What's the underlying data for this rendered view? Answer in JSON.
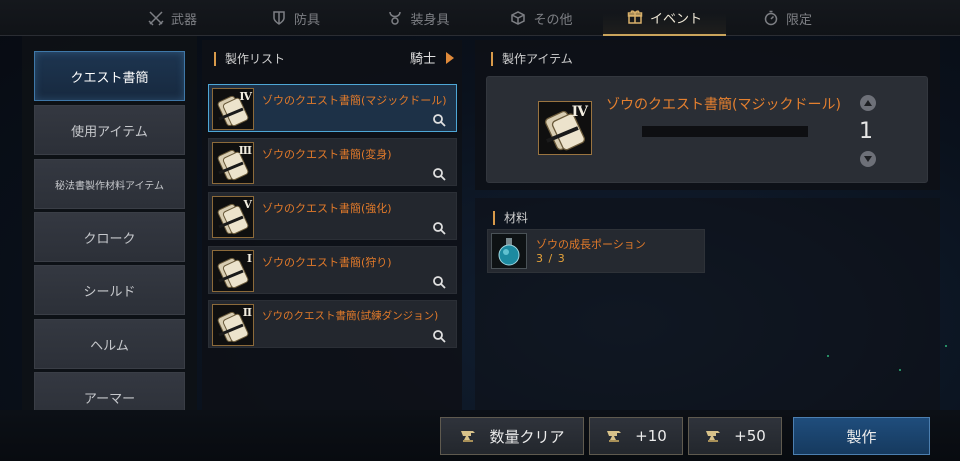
{
  "tabs": [
    {
      "label": "武器",
      "icon": "crossed-swords-icon"
    },
    {
      "label": "防具",
      "icon": "shield-icon"
    },
    {
      "label": "装身具",
      "icon": "necklace-icon"
    },
    {
      "label": "その他",
      "icon": "box-icon"
    },
    {
      "label": "イベント",
      "icon": "gift-icon"
    },
    {
      "label": "限定",
      "icon": "timer-icon"
    }
  ],
  "active_tab": "イベント",
  "categories": [
    "クエスト書簡",
    "使用アイテム",
    "秘法書製作材料アイテム",
    "クローク",
    "シールド",
    "ヘルム",
    "アーマー"
  ],
  "active_category": "クエスト書簡",
  "craft_list": {
    "header": "製作リスト",
    "class_filter": "騎士",
    "items": [
      {
        "name": "ゾウのクエスト書簡(マジックドール)",
        "numeral": "IV",
        "selected": true
      },
      {
        "name": "ゾウのクエスト書簡(変身)",
        "numeral": "III",
        "selected": false
      },
      {
        "name": "ゾウのクエスト書簡(強化)",
        "numeral": "V",
        "selected": false
      },
      {
        "name": "ゾウのクエスト書簡(狩り)",
        "numeral": "I",
        "selected": false
      },
      {
        "name": "ゾウのクエスト書簡(試練ダンジョン)",
        "numeral": "II",
        "selected": false
      }
    ]
  },
  "detail": {
    "header": "製作アイテム",
    "name": "ゾウのクエスト書簡(マジックドール)",
    "numeral": "IV",
    "quantity": "1"
  },
  "materials": {
    "header": "材料",
    "items": [
      {
        "name": "ゾウの成長ポーション",
        "count": "3 / 3",
        "icon": "potion-icon"
      }
    ]
  },
  "buttons": {
    "clear": "数量クリア",
    "plus10": "+10",
    "plus50": "+50",
    "craft": "製作"
  },
  "colors": {
    "accent_orange": "#e27a2a",
    "selected_blue": "#4ea7d6",
    "gold": "#c9a45c"
  }
}
